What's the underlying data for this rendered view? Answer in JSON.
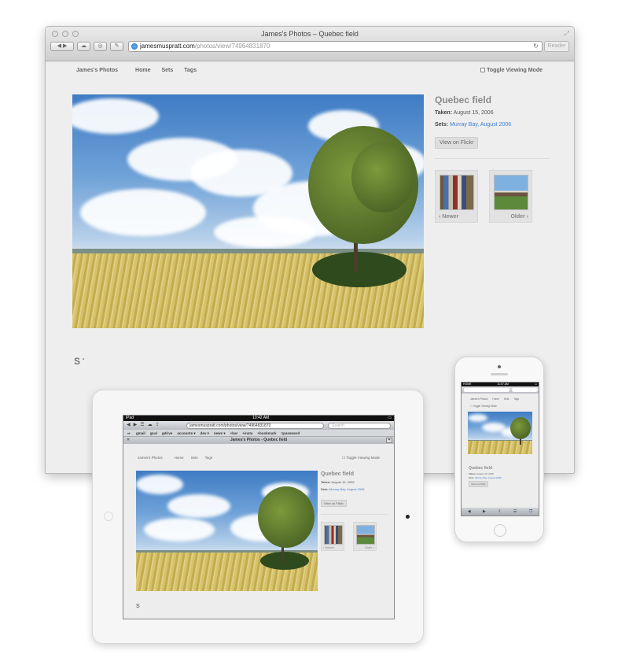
{
  "desktop": {
    "window_title": "James's Photos – Quebec field",
    "url_host": "jamesmuspratt.com",
    "url_path": "/photos/view/74964831870",
    "reader_label": "Reader",
    "nav": {
      "brand": "James's Photos",
      "home": "Home",
      "sets": "Sets",
      "tags": "Tags"
    },
    "toggle_label": "Toggle Viewing Mode",
    "photo": {
      "title": "Quebec field",
      "taken_label": "Taken:",
      "taken_value": "August 15, 2006",
      "sets_label": "Sets:",
      "sets_value": "Murray Bay, August 2006",
      "flickr_button": "View on Flickr"
    },
    "newer_label": "‹ Newer",
    "older_label": "Older ›",
    "logo_letter": "S",
    "logo_mark": "•"
  },
  "ipad": {
    "status_left": "iPad",
    "status_time": "10:42 AM",
    "url": "jamesmuspratt.com/photos/view/74964831870",
    "search_placeholder": "Search",
    "bookmarks": [
      "gmail",
      "gcal",
      "gdrive",
      "accounts ▾",
      "dev ▾",
      "news ▾",
      "+bar",
      "+insta",
      "+bookmark",
      "1password"
    ],
    "tab_title": "James's Photos - Quebec field",
    "nav": {
      "brand": "James's Photos",
      "home": "Home",
      "sets": "Sets",
      "tags": "Tags"
    },
    "toggle_label": "Toggle Viewing Mode",
    "photo_title": "Quebec field",
    "taken": "August 15, 2006",
    "sets": "Murray Bay, August 2006",
    "flickr_button": "View on Flickr",
    "newer_label": "‹ Newer",
    "older_label": "Older ›",
    "logo_letter": "S"
  },
  "iphone": {
    "status_carrier": "HOME",
    "status_time": "11:07 AM",
    "nav": {
      "brand": "James's Photos",
      "home": "Home",
      "sets": "Sets",
      "tags": "Tags"
    },
    "toggle_label": "Toggle Viewing Mode",
    "photo_title": "Quebec field",
    "taken": "August 15, 2006",
    "sets": "Murray Bay, August 2006",
    "flickr_button": "View on Flickr"
  }
}
